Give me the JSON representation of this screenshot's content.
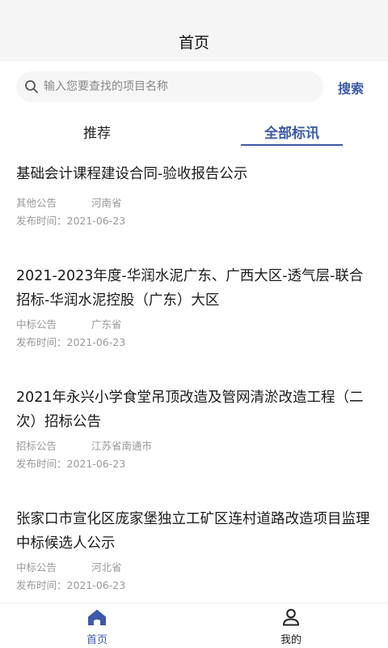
{
  "header": {
    "title": "首页"
  },
  "search": {
    "placeholder": "输入您要查找的项目名称",
    "button_label": "搜索"
  },
  "tabs": [
    {
      "label": "推荐",
      "active": false
    },
    {
      "label": "全部标讯",
      "active": true
    }
  ],
  "list": [
    {
      "title": "基础会计课程建设合同-验收报告公示",
      "type": "其他公告",
      "region": "河南省",
      "date": "发布时间：2021-06-23"
    },
    {
      "title": "2021-2023年度-华润水泥广东、广西大区-透气层-联合招标-华润水泥控股（广东）大区",
      "type": "中标公告",
      "region": "广东省",
      "date": "发布时间：2021-06-23"
    },
    {
      "title": "2021年永兴小学食堂吊顶改造及管网清淤改造工程（二次）招标公告",
      "type": "招标公告",
      "region": "江苏省南通市",
      "date": "发布时间：2021-06-23"
    },
    {
      "title": "张家口市宣化区庞家堡独立工矿区连村道路改造项目监理中标候选人公示",
      "type": "中标公告",
      "region": "河北省",
      "date": "发布时间：2021-06-23"
    }
  ],
  "bottom_nav": [
    {
      "label": "首页",
      "icon": "home-icon",
      "active": true
    },
    {
      "label": "我的",
      "icon": "user-icon",
      "active": false
    }
  ],
  "colors": {
    "accent": "#3d5aa8",
    "meta_text": "#999999",
    "header_bg": "#f5f5f5"
  }
}
